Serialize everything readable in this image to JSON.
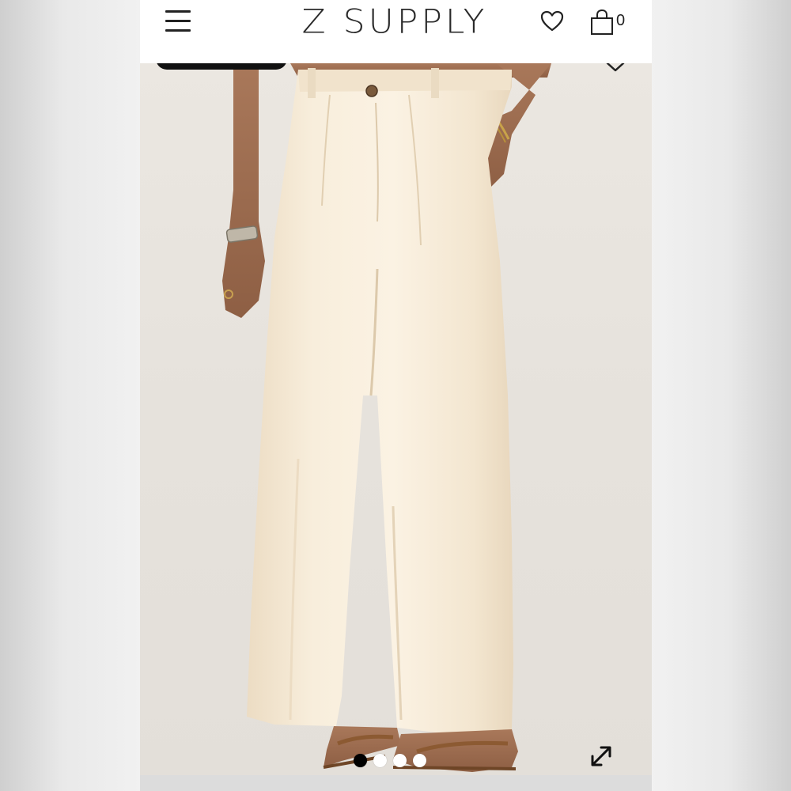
{
  "header": {
    "brand": "Z SUPPLY",
    "menu_icon": "hamburger-menu-icon",
    "wishlist_icon": "heart-icon",
    "bag_icon": "shopping-bag-icon",
    "bag_count": "0"
  },
  "gallery": {
    "image_subject": "product-photo-cream-wide-leg-pants",
    "collapse_icon": "chevron-down-icon",
    "expand_icon": "expand-arrows-icon",
    "slide_count": 4,
    "active_slide": 1
  },
  "colors": {
    "fabric": "#f6ead6",
    "background": "#e7e3dd",
    "dot_active": "#000000",
    "dot_inactive": "#ffffff"
  }
}
